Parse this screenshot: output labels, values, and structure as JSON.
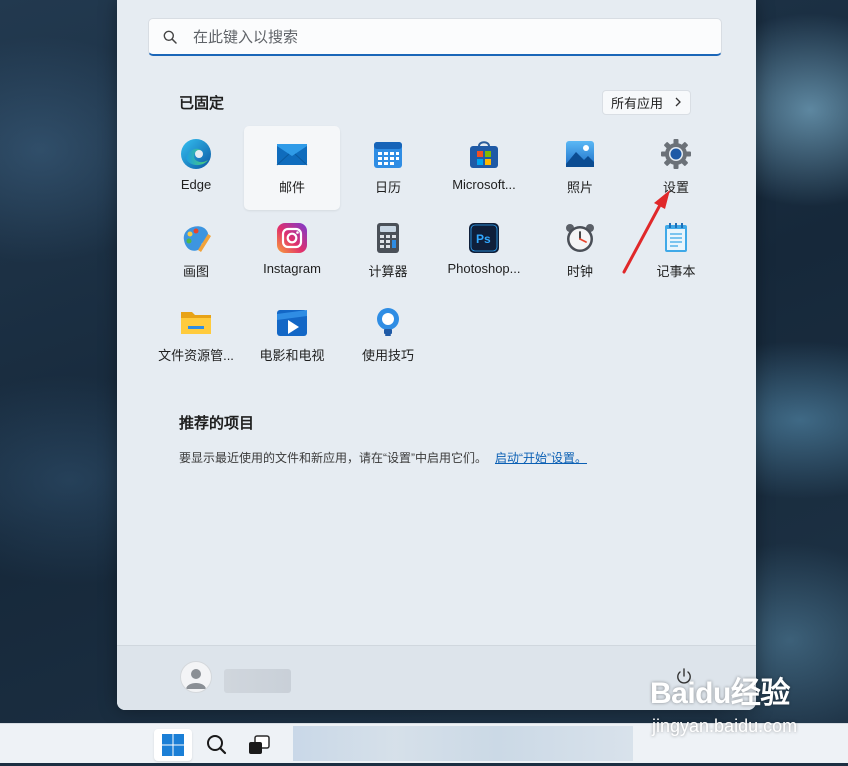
{
  "search": {
    "placeholder": "在此键入以搜索"
  },
  "pinned": {
    "title": "已固定",
    "all_apps_label": "所有应用",
    "apps": [
      {
        "label": "Edge",
        "icon": "edge-icon",
        "selected": false
      },
      {
        "label": "邮件",
        "icon": "mail-icon",
        "selected": true
      },
      {
        "label": "日历",
        "icon": "calendar-icon",
        "selected": false
      },
      {
        "label": "Microsoft...",
        "icon": "store-icon",
        "selected": false
      },
      {
        "label": "照片",
        "icon": "photos-icon",
        "selected": false
      },
      {
        "label": "设置",
        "icon": "settings-gear-icon",
        "selected": false
      },
      {
        "label": "画图",
        "icon": "paint-icon",
        "selected": false
      },
      {
        "label": "Instagram",
        "icon": "instagram-icon",
        "selected": false
      },
      {
        "label": "计算器",
        "icon": "calculator-icon",
        "selected": false
      },
      {
        "label": "Photoshop...",
        "icon": "photoshop-icon",
        "selected": false
      },
      {
        "label": "时钟",
        "icon": "clock-icon",
        "selected": false
      },
      {
        "label": "记事本",
        "icon": "notepad-icon",
        "selected": false
      },
      {
        "label": "文件资源管...",
        "icon": "file-explorer-icon",
        "selected": false
      },
      {
        "label": "电影和电视",
        "icon": "movies-tv-icon",
        "selected": false
      },
      {
        "label": "使用技巧",
        "icon": "tips-icon",
        "selected": false
      }
    ]
  },
  "recommended": {
    "title": "推荐的项目",
    "message": "要显示最近使用的文件和新应用，请在“设置”中启用它们。",
    "link": "启动“开始”设置。"
  },
  "watermark": {
    "logo": "Baidu经验",
    "url": "jingyan.baidu.com"
  },
  "colors": {
    "accent": "#1a66b8",
    "link": "#0a5fb4",
    "annotation_arrow": "#e0282a"
  }
}
